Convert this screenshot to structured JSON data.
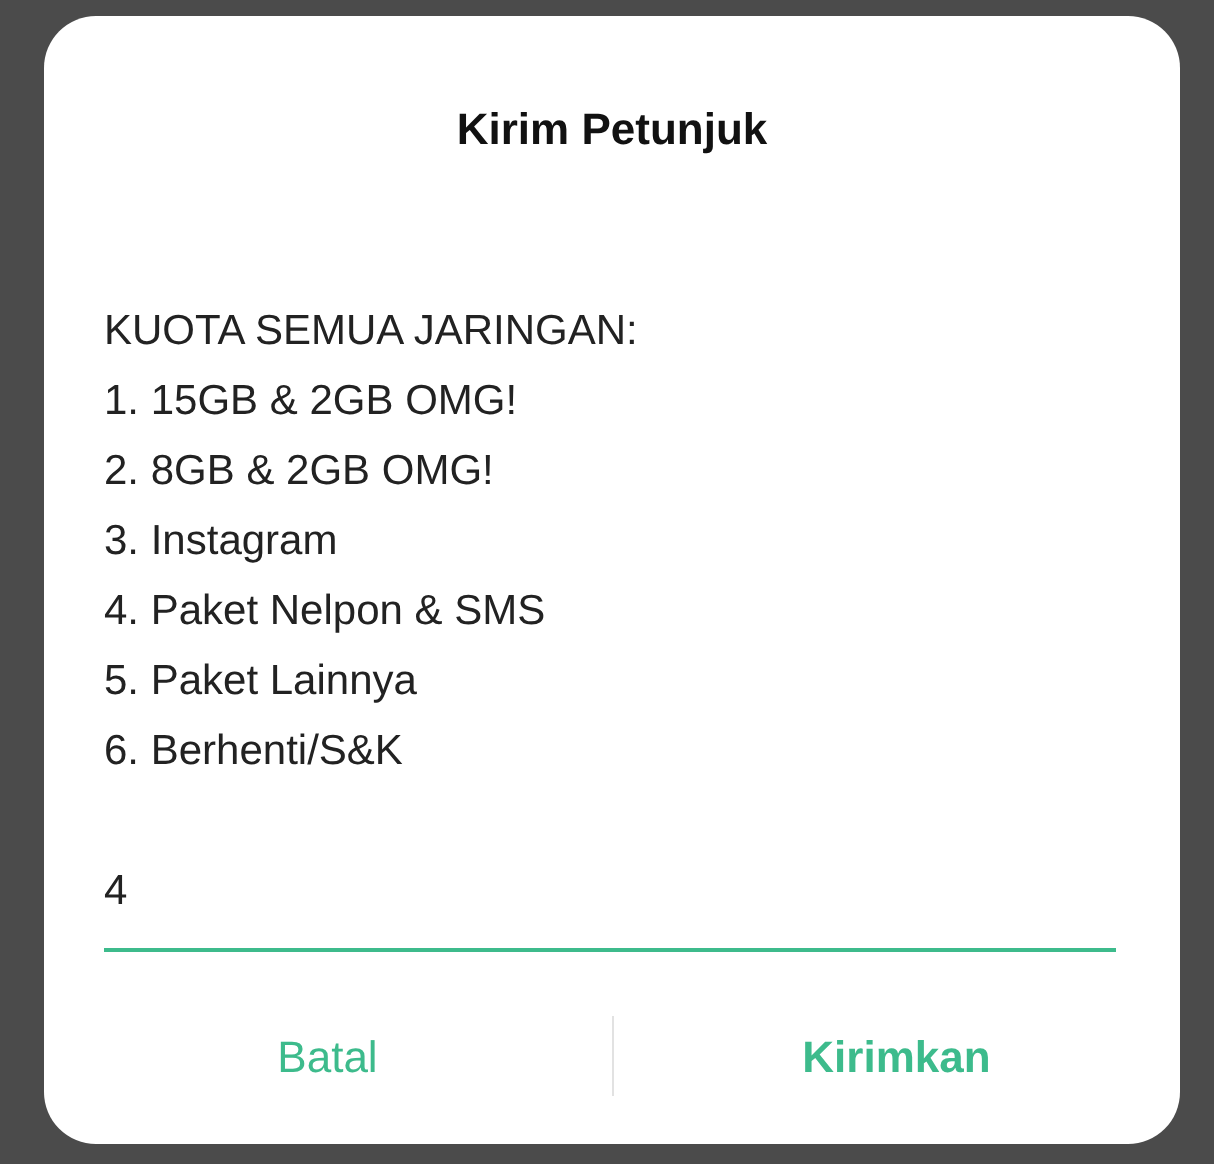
{
  "dialog": {
    "title": "Kirim Petunjuk",
    "message_lines": [
      "KUOTA SEMUA JARINGAN:",
      "1. 15GB & 2GB OMG!",
      "2. 8GB & 2GB OMG!",
      "3. Instagram",
      "4. Paket Nelpon & SMS",
      "5. Paket Lainnya",
      "6. Berhenti/S&K"
    ],
    "input": {
      "value": "4"
    },
    "buttons": [
      {
        "label": "Batal",
        "kind": "secondary"
      },
      {
        "label": "Kirimkan",
        "kind": "primary"
      }
    ]
  }
}
